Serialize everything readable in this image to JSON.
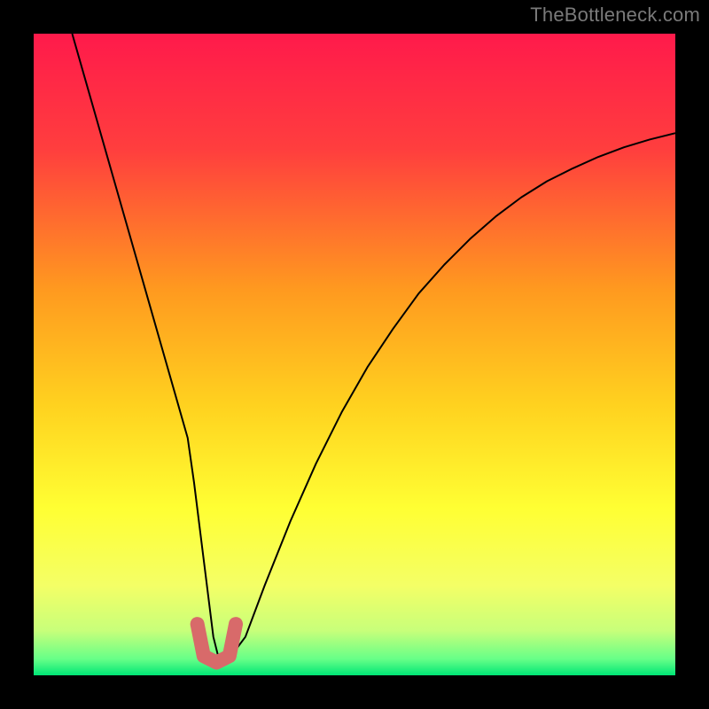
{
  "watermark": "TheBottleneck.com",
  "chart_data": {
    "type": "line",
    "title": "",
    "xlabel": "",
    "ylabel": "",
    "xlim": [
      0,
      100
    ],
    "ylim": [
      0,
      100
    ],
    "grid": false,
    "legend": false,
    "background_gradient_stops": [
      {
        "offset": 0.0,
        "color": "#ff1a4b"
      },
      {
        "offset": 0.18,
        "color": "#ff3e3e"
      },
      {
        "offset": 0.4,
        "color": "#ff9a1f"
      },
      {
        "offset": 0.58,
        "color": "#ffd21f"
      },
      {
        "offset": 0.74,
        "color": "#ffff33"
      },
      {
        "offset": 0.86,
        "color": "#f4ff66"
      },
      {
        "offset": 0.93,
        "color": "#c8ff7a"
      },
      {
        "offset": 0.975,
        "color": "#66ff88"
      },
      {
        "offset": 1.0,
        "color": "#00e676"
      }
    ],
    "series": [
      {
        "name": "bottleneck-curve",
        "color": "#000000",
        "stroke_width": 2.0,
        "x": [
          6,
          8,
          10,
          12,
          14,
          16,
          18,
          20,
          22,
          24,
          25,
          26,
          27,
          28,
          29,
          30,
          33,
          36,
          40,
          44,
          48,
          52,
          56,
          60,
          64,
          68,
          72,
          76,
          80,
          84,
          88,
          92,
          96,
          100
        ],
        "y": [
          100,
          93,
          86,
          79,
          72,
          65,
          58,
          51,
          44,
          37,
          30,
          22,
          14,
          6,
          2,
          2,
          6,
          14,
          24,
          33,
          41,
          48,
          54,
          59.5,
          64,
          68,
          71.5,
          74.5,
          77,
          79,
          80.8,
          82.3,
          83.5,
          84.5
        ]
      },
      {
        "name": "optimal-marker",
        "color": "#d86a6a",
        "stroke_width": 16,
        "linecap": "round",
        "x": [
          25.5,
          26.5,
          28.5,
          30.5,
          31.5
        ],
        "y": [
          8,
          3,
          2,
          3,
          8
        ]
      }
    ]
  }
}
